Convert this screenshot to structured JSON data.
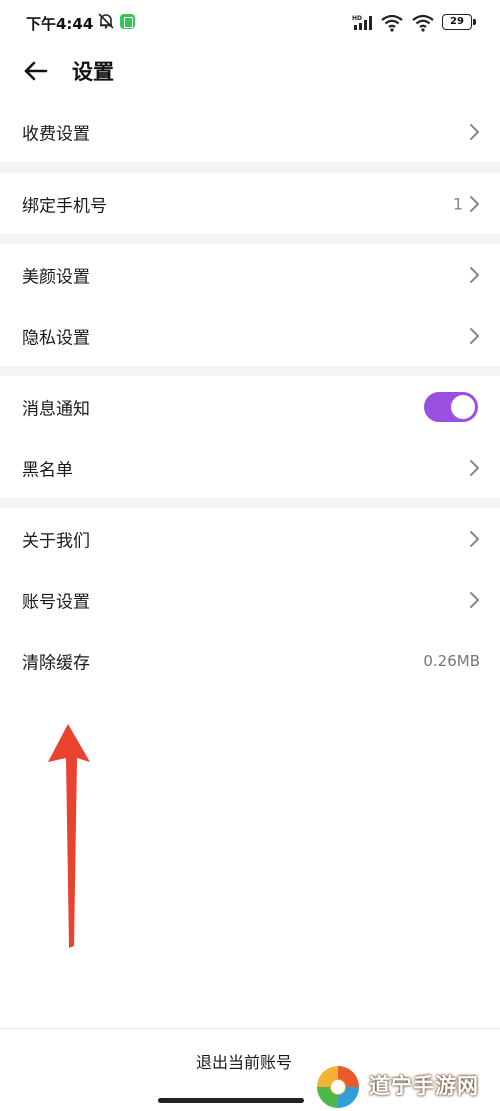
{
  "status_bar": {
    "time": "下午4:44",
    "battery": "29",
    "icons": [
      "bell-off-icon",
      "app-notification-icon",
      "signal-icon",
      "wifi-icon",
      "wifi-icon",
      "battery-icon"
    ]
  },
  "header": {
    "title": "设置",
    "back_icon": "arrow-left-icon"
  },
  "settings": {
    "fee": "收费设置",
    "bind_phone": "绑定手机号",
    "bind_phone_value": "1",
    "beauty": "美颜设置",
    "privacy": "隐私设置",
    "notify": "消息通知",
    "notify_enabled": true,
    "blacklist": "黑名单",
    "about": "关于我们",
    "account": "账号设置",
    "cache": "清除缓存",
    "cache_size": "0.26MB"
  },
  "footer": {
    "logout": "退出当前账号"
  },
  "watermark": {
    "text": "道宁手游网"
  },
  "colors": {
    "toggle_on": "#9b4fe0",
    "annotation_arrow": "#e8432e",
    "section_gap": "#f4f4f6"
  }
}
